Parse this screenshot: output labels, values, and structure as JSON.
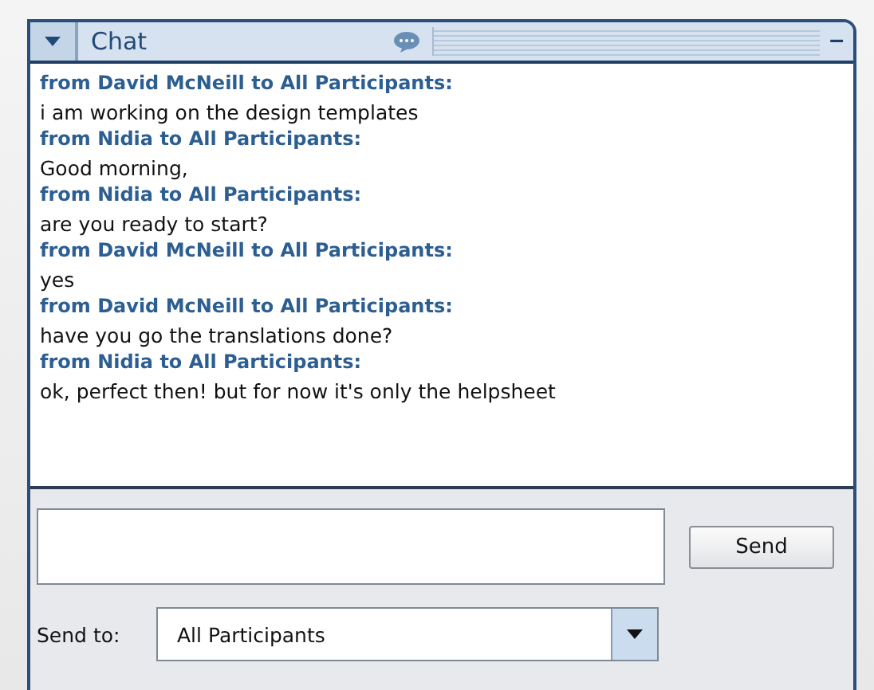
{
  "panel": {
    "title": "Chat",
    "minimize": "–"
  },
  "messages": [
    {
      "sender": "from David McNeill to All Participants:",
      "text": "i am working on the design templates"
    },
    {
      "sender": "from Nidia to All Participants:",
      "text": "Good morning,"
    },
    {
      "sender": "from Nidia to All Participants:",
      "text": "are you ready to start?"
    },
    {
      "sender": "from David McNeill to All Participants:",
      "text": "yes"
    },
    {
      "sender": "from David McNeill to All Participants:",
      "text": "have you go the translations done?"
    },
    {
      "sender": "from Nidia to All Participants:",
      "text": "ok, perfect then! but for now it's only the helpsheet"
    }
  ],
  "send_button": "Send",
  "send_to": {
    "label": "Send to:",
    "value": "All Participants"
  }
}
